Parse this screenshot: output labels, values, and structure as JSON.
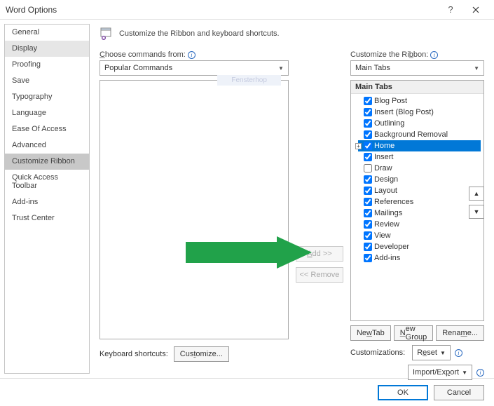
{
  "window": {
    "title": "Word Options"
  },
  "sidebar": {
    "items": [
      {
        "label": "General"
      },
      {
        "label": "Display"
      },
      {
        "label": "Proofing"
      },
      {
        "label": "Save"
      },
      {
        "label": "Typography"
      },
      {
        "label": "Language"
      },
      {
        "label": "Ease Of Access"
      },
      {
        "label": "Advanced"
      },
      {
        "label": "Customize Ribbon"
      },
      {
        "label": "Quick Access Toolbar"
      },
      {
        "label": "Add-ins"
      },
      {
        "label": "Trust Center"
      }
    ],
    "highlighted_index": 1,
    "selected_index": 8
  },
  "content": {
    "heading": "Customize the Ribbon and keyboard shortcuts.",
    "commands_label": "Choose commands from:",
    "commands_combo": "Popular Commands",
    "watermark": "Fensterhop",
    "ribbon_label": "Customize the Ribbon:",
    "ribbon_combo": "Main Tabs",
    "tabs_header": "Main Tabs",
    "tabs": [
      {
        "label": "Blog Post",
        "checked": true
      },
      {
        "label": "Insert (Blog Post)",
        "checked": true
      },
      {
        "label": "Outlining",
        "checked": true
      },
      {
        "label": "Background Removal",
        "checked": true
      },
      {
        "label": "Home",
        "checked": true,
        "selected": true,
        "expander": "+"
      },
      {
        "label": "Insert",
        "checked": true
      },
      {
        "label": "Draw",
        "checked": false
      },
      {
        "label": "Design",
        "checked": true
      },
      {
        "label": "Layout",
        "checked": true
      },
      {
        "label": "References",
        "checked": true
      },
      {
        "label": "Mailings",
        "checked": true
      },
      {
        "label": "Review",
        "checked": true
      },
      {
        "label": "View",
        "checked": true
      },
      {
        "label": "Developer",
        "checked": true
      },
      {
        "label": "Add-ins",
        "checked": true
      }
    ],
    "add_btn": "Add >>",
    "remove_btn": "<< Remove",
    "new_tab_btn": "New Tab",
    "new_group_btn": "New Group",
    "rename_btn": "Rename...",
    "customizations_label": "Customizations:",
    "reset_btn": "Reset",
    "import_export_btn": "Import/Export",
    "kb_label": "Keyboard shortcuts:",
    "kb_btn": "Customize..."
  },
  "footer": {
    "ok": "OK",
    "cancel": "Cancel"
  },
  "annotation": {
    "arrow_color": "#21a24a"
  }
}
